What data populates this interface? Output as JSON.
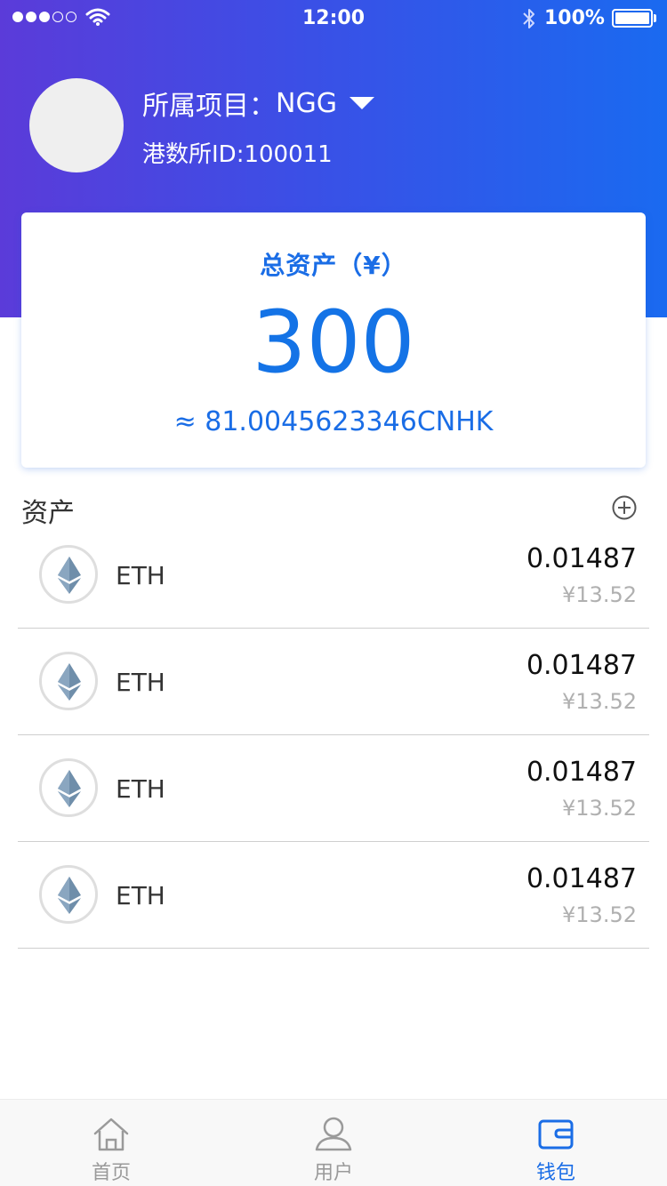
{
  "status_bar": {
    "time": "12:00",
    "battery": "100%"
  },
  "profile": {
    "project_label": "所属项目：",
    "project_value": "NGG",
    "exchange_id": "港数所ID:100011"
  },
  "assets_card": {
    "title": "总资产（¥）",
    "amount": "300",
    "approx": "≈ 81.0045623346CNHK"
  },
  "asset_section": {
    "title": "资产",
    "items": [
      {
        "name": "ETH",
        "amount": "0.01487",
        "value": "¥13.52"
      },
      {
        "name": "ETH",
        "amount": "0.01487",
        "value": "¥13.52"
      },
      {
        "name": "ETH",
        "amount": "0.01487",
        "value": "¥13.52"
      },
      {
        "name": "ETH",
        "amount": "0.01487",
        "value": "¥13.52"
      }
    ]
  },
  "tab_bar": {
    "home": "首页",
    "user": "用户",
    "wallet": "钱包"
  },
  "colors": {
    "accent": "#1a6de6",
    "gradient_start": "#5b3bd9",
    "gradient_end": "#1a6af0"
  }
}
